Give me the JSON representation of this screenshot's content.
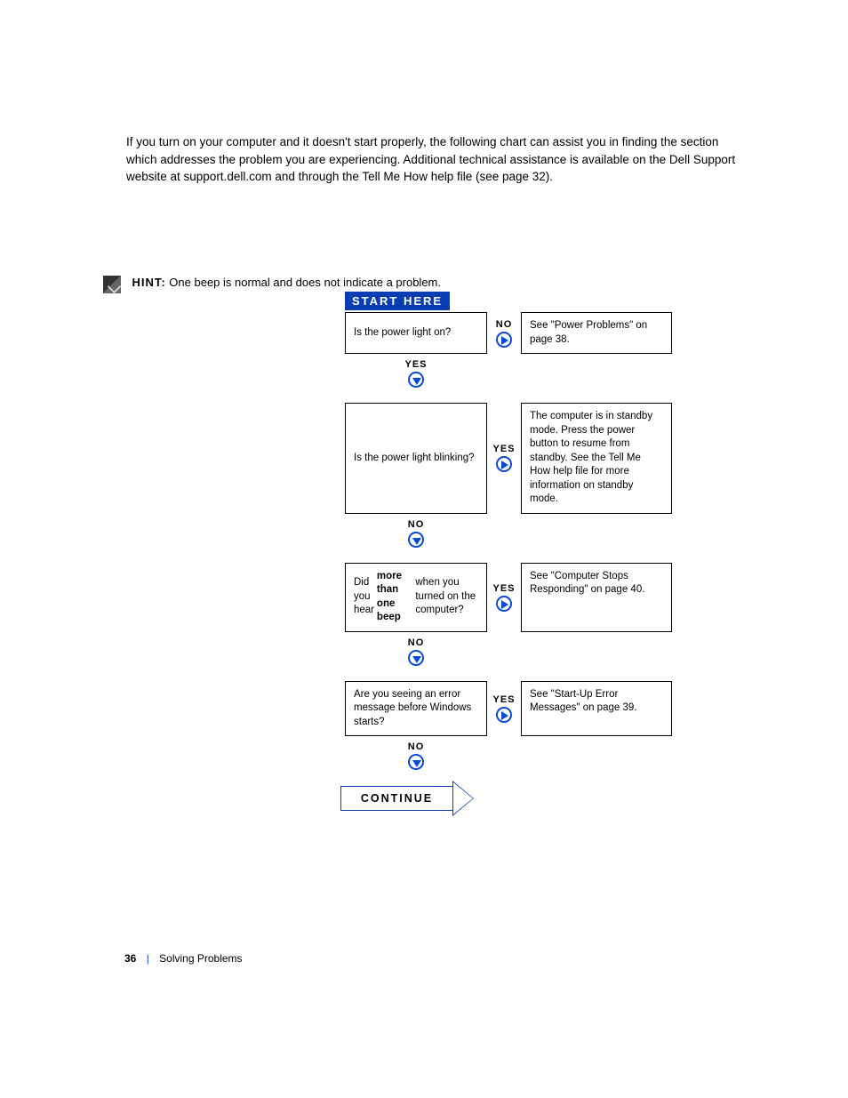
{
  "intro": "If you turn on your computer and it doesn't start properly, the following chart can assist you in finding the section which addresses the problem you are experiencing. Additional technical assistance is available on the Dell Support website at support.dell.com and through the Tell Me How help file (see page 32).",
  "note": {
    "hint": "HINT:",
    "text": "One beep is normal and does not indicate a problem."
  },
  "flow": {
    "start": "START HERE",
    "steps": [
      {
        "q": "Is the power light on?",
        "branch": "NO",
        "a": "See \"Power Problems\" on page 38.",
        "down": "YES"
      },
      {
        "q": "Is the power light blinking?",
        "branch": "YES",
        "a": "The computer is in standby mode. Press the power button to resume from standby. See the Tell Me How help file for more information on standby mode.",
        "down": "NO"
      },
      {
        "q_pre": "Did you hear ",
        "q_bold": "more than one beep",
        "q_post": " when you turned on the computer?",
        "branch": "YES",
        "a": "See \"Computer Stops Responding\" on page 40.",
        "down": "NO"
      },
      {
        "q": "Are you seeing an error message before Windows starts?",
        "branch": "YES",
        "a": "See \"Start-Up Error Messages\" on page 39.",
        "down": "NO"
      }
    ],
    "continue": "CONTINUE"
  },
  "footer": {
    "page": "36",
    "section": "Solving Problems"
  }
}
